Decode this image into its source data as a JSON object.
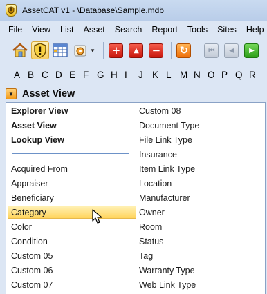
{
  "window": {
    "title": "AssetCAT v1 - \\Database\\Sample.mdb",
    "app_icon_letter": ""
  },
  "menu": [
    "File",
    "View",
    "List",
    "Asset",
    "Search",
    "Report",
    "Tools",
    "Sites",
    "Help"
  ],
  "toolbar": {
    "buttons": [
      {
        "name": "home-icon"
      },
      {
        "name": "shield-icon",
        "active": true
      },
      {
        "name": "grid-icon"
      },
      {
        "name": "gear-dropdown-icon"
      },
      {
        "name": "add-icon",
        "color": "#d42a1c"
      },
      {
        "name": "move-up-icon",
        "color": "#d42a1c"
      },
      {
        "name": "remove-icon",
        "color": "#d42a1c"
      },
      {
        "name": "refresh-icon",
        "color": "#f07c10"
      },
      {
        "name": "first-record-icon",
        "disabled": true
      },
      {
        "name": "previous-record-icon",
        "disabled": true
      },
      {
        "name": "next-record-icon",
        "color": "#2c9e1a"
      }
    ],
    "glyphs": {
      "add": "+",
      "up": "▲",
      "remove": "−",
      "refresh": "↻",
      "first": "⏮",
      "prev": "◀",
      "next": "▶",
      "dropdown": "▼"
    }
  },
  "alphabet": [
    "A",
    "B",
    "C",
    "D",
    "E",
    "F",
    "G",
    "H",
    "I",
    "J",
    "K",
    "L",
    "M",
    "N",
    "O",
    "P",
    "Q",
    "R"
  ],
  "section": {
    "title": "Asset View",
    "toggle_glyph": "▼"
  },
  "dropdown": {
    "views": [
      "Explorer View",
      "Asset View",
      "Lookup View"
    ],
    "left_items": [
      "Acquired From",
      "Appraiser",
      "Beneficiary",
      "Category",
      "Color",
      "Condition",
      "Custom 05",
      "Custom 06",
      "Custom 07"
    ],
    "right_items": [
      "Custom 08",
      "Document Type",
      "File Link Type",
      "Insurance",
      "Item Link Type",
      "Location",
      "Manufacturer",
      "Owner",
      "Room",
      "Status",
      "Tag",
      "Warranty Type",
      "Web Link Type"
    ],
    "hovered": "Category"
  },
  "colors": {
    "accent_hover": "#ffd45c",
    "header_bg": "#dce6f4",
    "separator": "#6d92c8"
  }
}
